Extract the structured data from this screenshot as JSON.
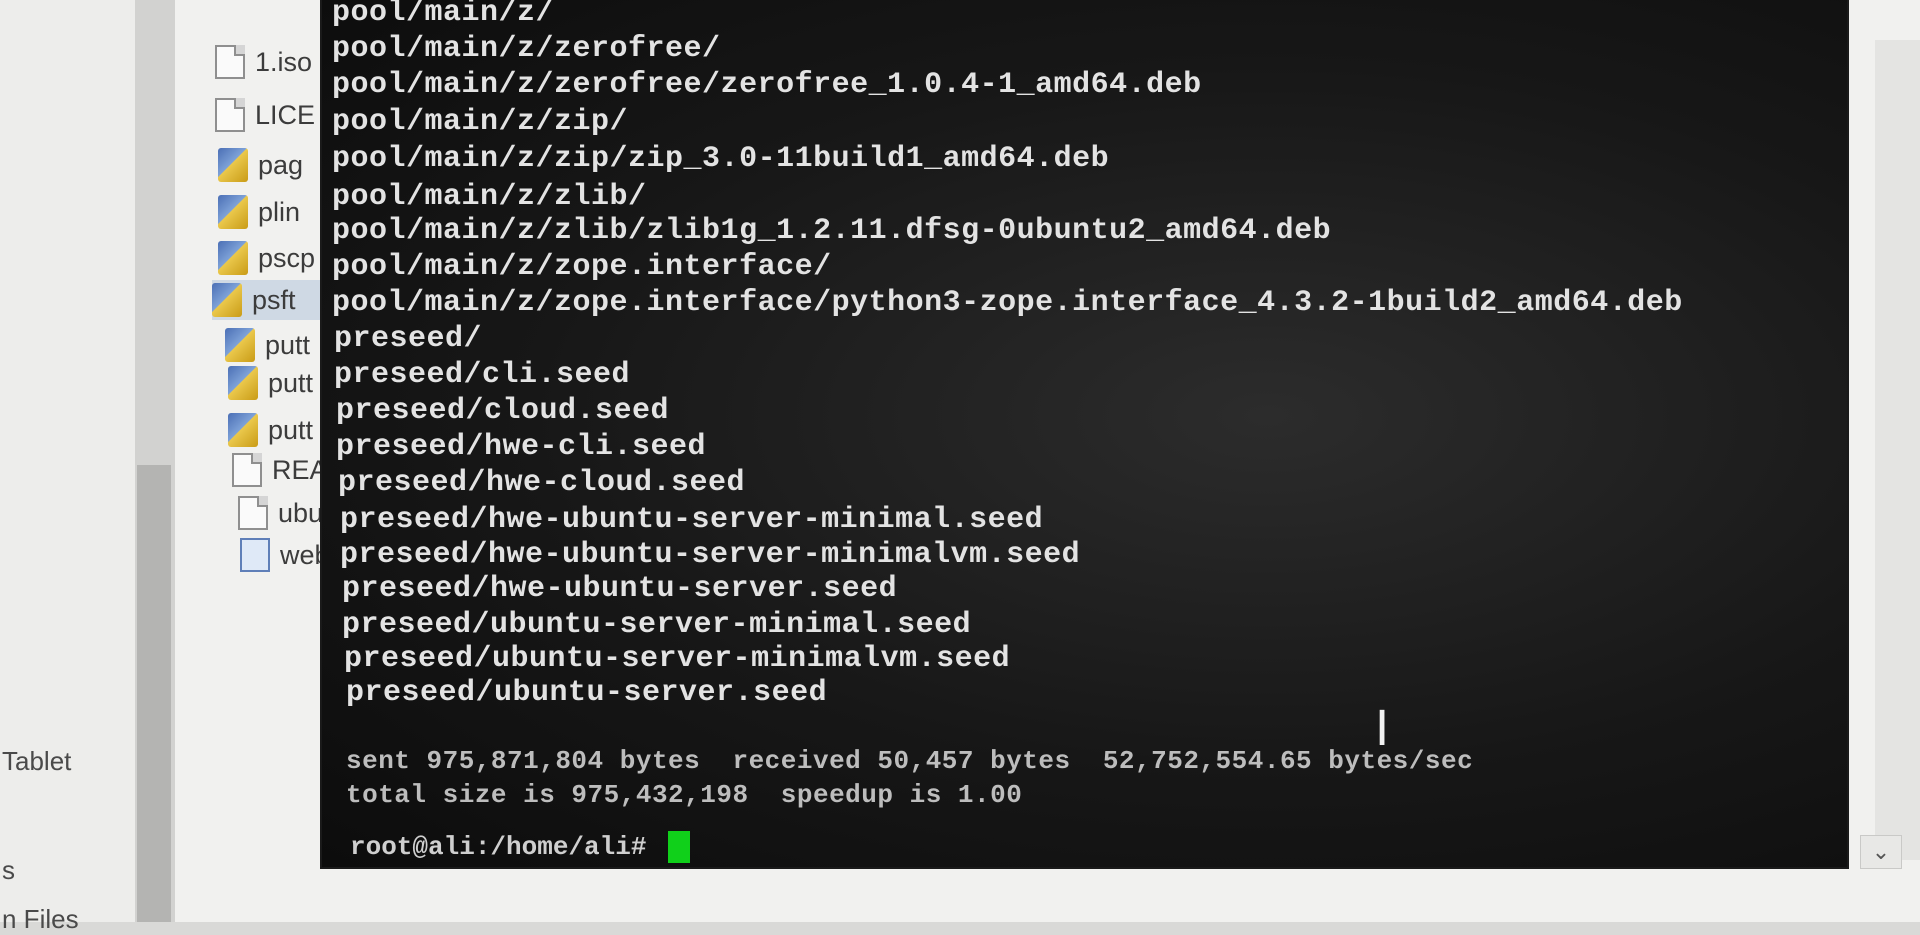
{
  "nav": {
    "items": [
      "Tablet",
      "s",
      "n Files"
    ]
  },
  "files": [
    {
      "name": "1.iso",
      "icon": "file-icon",
      "selected": false
    },
    {
      "name": "LICE",
      "icon": "file-icon",
      "selected": false
    },
    {
      "name": "pag",
      "icon": "putty-icon",
      "selected": false
    },
    {
      "name": "plin",
      "icon": "putty-icon",
      "selected": false
    },
    {
      "name": "pscp",
      "icon": "putty-icon",
      "selected": false
    },
    {
      "name": "psft",
      "icon": "putty-icon",
      "selected": true
    },
    {
      "name": "putt",
      "icon": "putty-icon",
      "selected": false
    },
    {
      "name": "putt",
      "icon": "putty-icon",
      "selected": false
    },
    {
      "name": "putt",
      "icon": "putty-icon",
      "selected": false
    },
    {
      "name": "REA",
      "icon": "file-icon",
      "selected": false
    },
    {
      "name": "ubu",
      "icon": "file-icon",
      "selected": false
    },
    {
      "name": "web",
      "icon": "web-icon",
      "selected": false
    }
  ],
  "terminal": {
    "lines": [
      "pool/main/z/",
      "pool/main/z/zerofree/",
      "pool/main/z/zerofree/zerofree_1.0.4-1_amd64.deb",
      "pool/main/z/zip/",
      "pool/main/z/zip/zip_3.0-11build1_amd64.deb",
      "pool/main/z/zlib/",
      "pool/main/z/zlib/zlib1g_1.2.11.dfsg-0ubuntu2_amd64.deb",
      "pool/main/z/zope.interface/",
      "pool/main/z/zope.interface/python3-zope.interface_4.3.2-1build2_amd64.deb",
      "preseed/",
      "preseed/cli.seed",
      "preseed/cloud.seed",
      "preseed/hwe-cli.seed",
      "preseed/hwe-cloud.seed",
      "preseed/hwe-ubuntu-server-minimal.seed",
      "preseed/hwe-ubuntu-server-minimalvm.seed",
      "preseed/hwe-ubuntu-server.seed",
      "preseed/ubuntu-server-minimal.seed",
      "preseed/ubuntu-server-minimalvm.seed",
      "preseed/ubuntu-server.seed",
      "",
      "sent 975,871,804 bytes  received 50,457 bytes  52,752,554.65 bytes/sec",
      "total size is 975,432,198  speedup is 1.00"
    ],
    "prompt": "root@ali:/home/ali# ",
    "cursor_color": "#10d01a"
  },
  "scroll_down_glyph": "⌄"
}
